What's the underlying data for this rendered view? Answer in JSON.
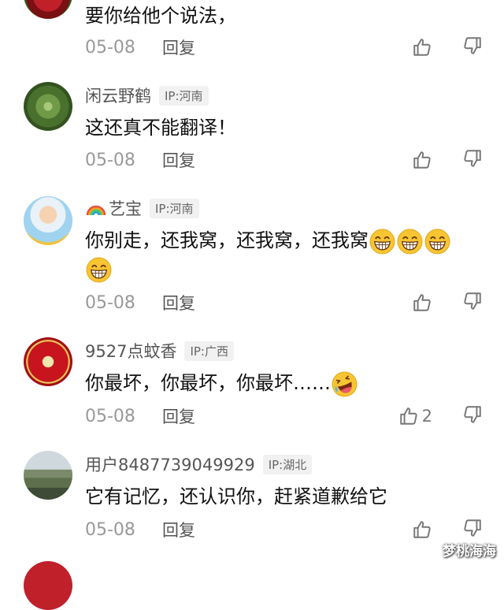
{
  "comments": [
    {
      "text": "要你给他个说法，",
      "date": "05-08",
      "reply_label": "回复"
    },
    {
      "username": "闲云野鹤",
      "ip": "IP:河南",
      "text": "这还真不能翻译！",
      "date": "05-08",
      "reply_label": "回复"
    },
    {
      "username": "艺宝",
      "ip": "IP:河南",
      "text_line1": "你别走，还我窝，还我窝，还我窝",
      "date": "05-08",
      "reply_label": "回复"
    },
    {
      "username": "9527点蚊香",
      "ip": "IP:广西",
      "text": "你最坏，你最坏，你最坏……",
      "date": "05-08",
      "reply_label": "回复",
      "like_count": "2"
    },
    {
      "username": "用户8487739049929",
      "ip": "IP:湖北",
      "text": "它有记忆，还认识你，赶紧道歉给它",
      "date": "05-08",
      "reply_label": "回复"
    }
  ],
  "icons": {
    "like": "thumbs-up-icon",
    "dislike": "thumbs-down-icon",
    "emoji_grin": "grinning-face-icon",
    "emoji_laugh": "rolling-laughing-face-icon",
    "rainbow": "rainbow-icon"
  },
  "colors": {
    "meta_gray": "#999999",
    "ip_badge_bg": "#f1f1f1",
    "emoji_yellow": "#f7c531"
  },
  "watermark": "梦桃海海"
}
